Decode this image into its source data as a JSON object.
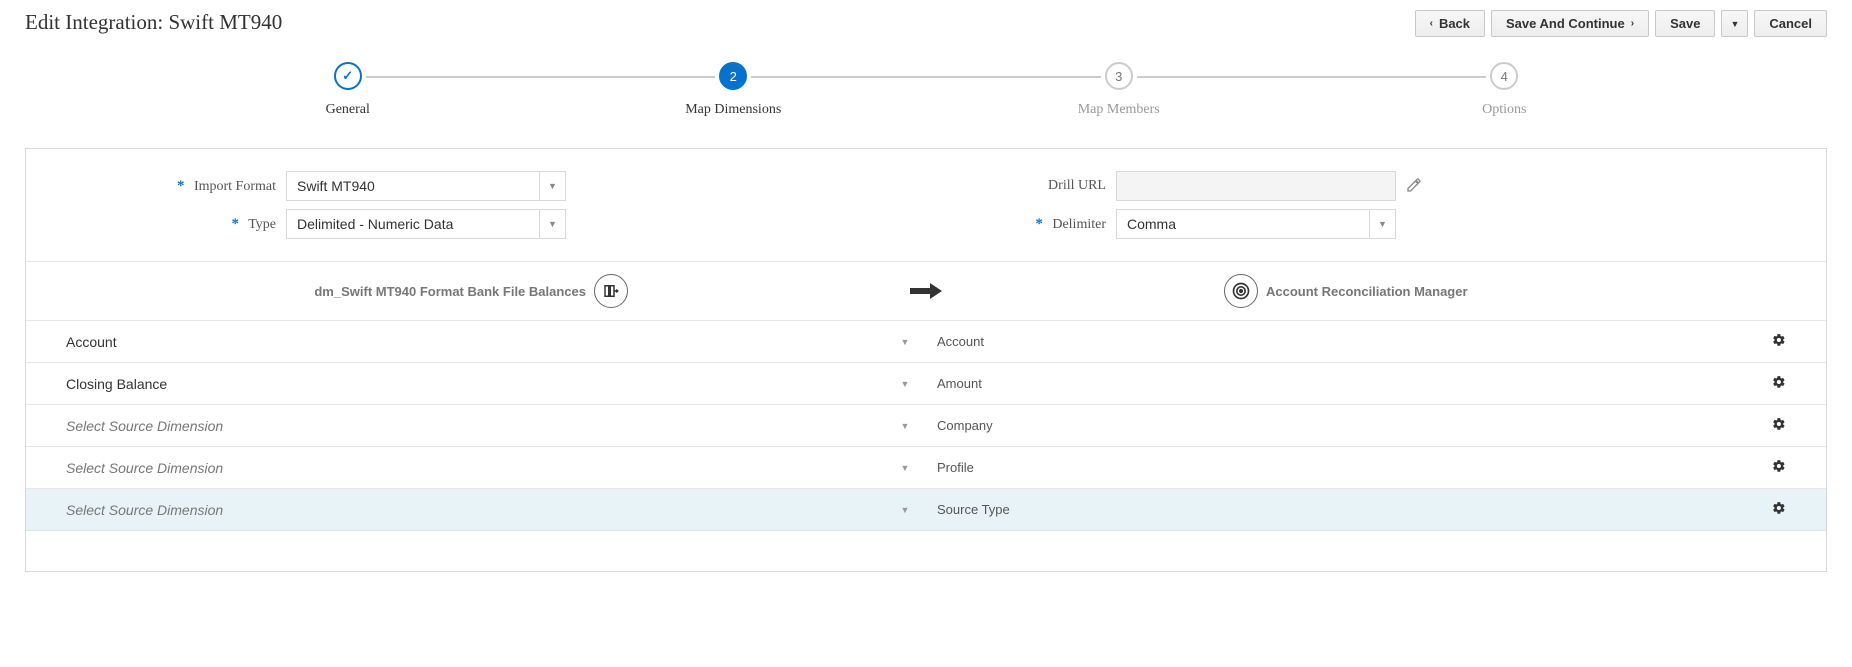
{
  "page_title": "Edit Integration: Swift MT940",
  "toolbar": {
    "back": "Back",
    "save_continue": "Save And Continue",
    "save": "Save",
    "cancel": "Cancel"
  },
  "wizard": {
    "steps": [
      {
        "marker": "✓",
        "label": "General",
        "state": "done"
      },
      {
        "marker": "2",
        "label": "Map Dimensions",
        "state": "active"
      },
      {
        "marker": "3",
        "label": "Map Members",
        "state": "future"
      },
      {
        "marker": "4",
        "label": "Options",
        "state": "future"
      }
    ]
  },
  "form": {
    "import_format_label": "Import Format",
    "import_format_value": "Swift MT940",
    "type_label": "Type",
    "type_value": "Delimited - Numeric Data",
    "drill_url_label": "Drill URL",
    "drill_url_value": "",
    "delimiter_label": "Delimiter",
    "delimiter_value": "Comma"
  },
  "flow": {
    "source_label": "dm_Swift MT940 Format Bank File Balances",
    "target_label": "Account Reconciliation Manager"
  },
  "mapping": [
    {
      "source": "Account",
      "placeholder": false,
      "target": "Account",
      "selected": false
    },
    {
      "source": "Closing Balance",
      "placeholder": false,
      "target": "Amount",
      "selected": false
    },
    {
      "source": "Select Source Dimension",
      "placeholder": true,
      "target": "Company",
      "selected": false
    },
    {
      "source": "Select Source Dimension",
      "placeholder": true,
      "target": "Profile",
      "selected": false
    },
    {
      "source": "Select Source Dimension",
      "placeholder": true,
      "target": "Source Type",
      "selected": true
    }
  ]
}
